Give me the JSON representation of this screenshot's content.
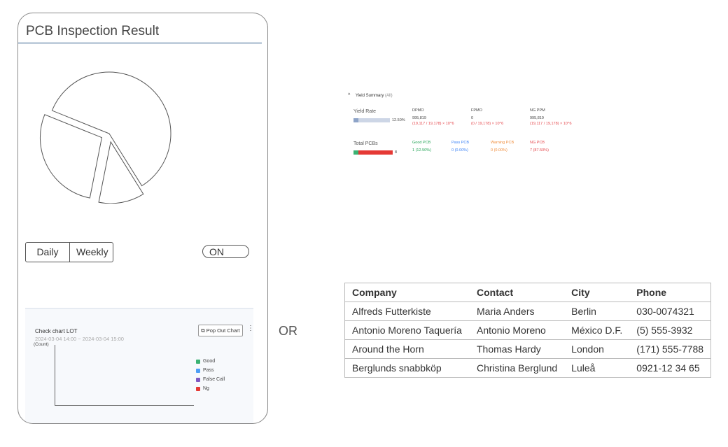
{
  "card": {
    "title": "PCB Inspection Result",
    "pie_slices": [
      60,
      12,
      28
    ],
    "range_tabs": [
      "Daily",
      "Weekly"
    ],
    "toggle_label": "ON",
    "mini_chart": {
      "title": "Check chart LOT",
      "range": "2024-03-04 14:00 ~ 2024-03-04 15:00",
      "y_label": "(Count)",
      "popout_label": "Pop Out Chart",
      "legend": [
        {
          "label": "Good",
          "color": "#3bb273"
        },
        {
          "label": "Pass",
          "color": "#4d9ef5"
        },
        {
          "label": "False Call",
          "color": "#7e57c2"
        },
        {
          "label": "Ng",
          "color": "#e53935"
        }
      ]
    }
  },
  "separator_text": "OR",
  "yield_summary": {
    "title": "Yield Summary",
    "subtitle": "(All)",
    "yield_rate_label": "Yield Rate",
    "yield_rate_value": "12.50%",
    "total_pcbs_label": "Total PCBs",
    "total_pcbs_value": "8",
    "dpmo": {
      "label": "DPMO",
      "value": "995,819",
      "formula": "(19,117 / 19,178) × 10^6"
    },
    "fpmo": {
      "label": "FPMO",
      "value": "0",
      "formula": "(0 / 19,178) × 10^6"
    },
    "ng_ppm": {
      "label": "NG PPM",
      "value": "995,819",
      "formula": "(19,117 / 19,178) × 10^6"
    },
    "good_pcb": {
      "label": "Good PCB",
      "value": "1 (12.50%)"
    },
    "pass_pcb": {
      "label": "Pass PCB",
      "value": "0 (0.00%)"
    },
    "warning_pcb": {
      "label": "Warning PCB",
      "value": "0 (0.00%)"
    },
    "ng_pcb": {
      "label": "NG PCB",
      "value": "7 (87.50%)"
    }
  },
  "table": {
    "headers": [
      "Company",
      "Contact",
      "City",
      "Phone"
    ],
    "rows": [
      [
        "Alfreds Futterkiste",
        "Maria Anders",
        "Berlin",
        "030-0074321"
      ],
      [
        "Antonio Moreno Taquería",
        "Antonio Moreno",
        "México D.F.",
        "(5) 555-3932"
      ],
      [
        "Around the Horn",
        "Thomas Hardy",
        "London",
        "(171) 555-7788"
      ],
      [
        "Berglunds snabbköp",
        "Christina Berglund",
        "Luleå",
        "0921-12 34 65"
      ]
    ]
  }
}
